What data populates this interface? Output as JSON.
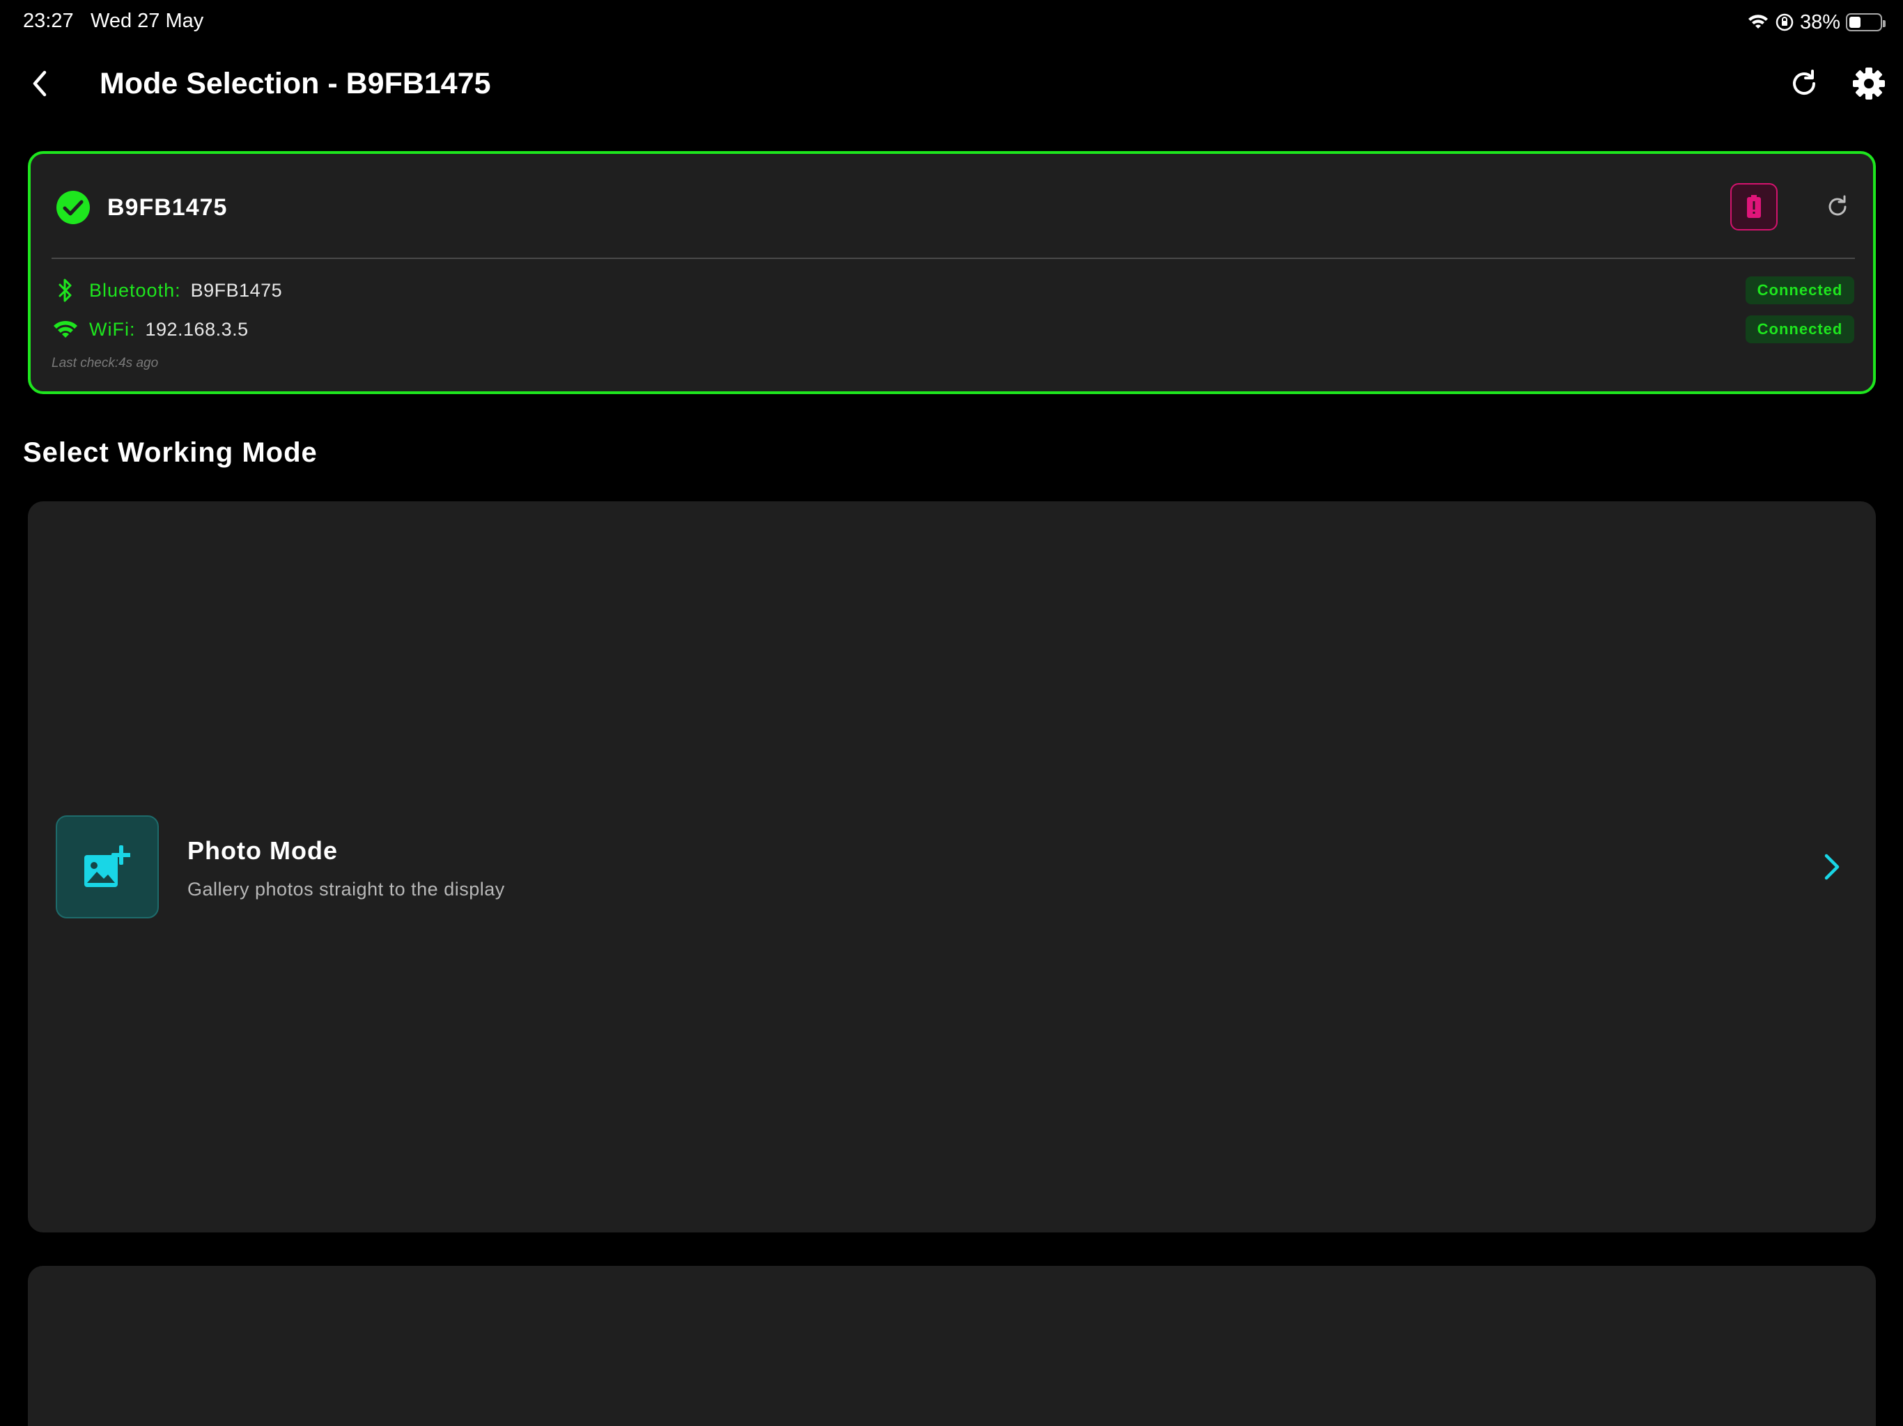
{
  "status_bar": {
    "time": "23:27",
    "date": "Wed 27 May",
    "battery_percent": "38%",
    "battery_level": 0.38
  },
  "nav": {
    "title": "Mode Selection - B9FB1475"
  },
  "device": {
    "name": "B9FB1475",
    "bluetooth_label": "Bluetooth:",
    "bluetooth_value": "B9FB1475",
    "bluetooth_status": "Connected",
    "wifi_label": "WiFi:",
    "wifi_value": "192.168.3.5",
    "wifi_status": "Connected",
    "last_check": "Last check:4s ago"
  },
  "section": {
    "title": "Select Working Mode"
  },
  "modes": [
    {
      "title": "Photo Mode",
      "subtitle": "Gallery photos straight to the display",
      "icon": "add-photo-icon"
    }
  ],
  "colors": {
    "background": "#000000",
    "card": "#1f1f1f",
    "accent_green": "#1ee61e",
    "accent_cyan": "#19d6e6",
    "battery_pink": "#e0157a"
  }
}
